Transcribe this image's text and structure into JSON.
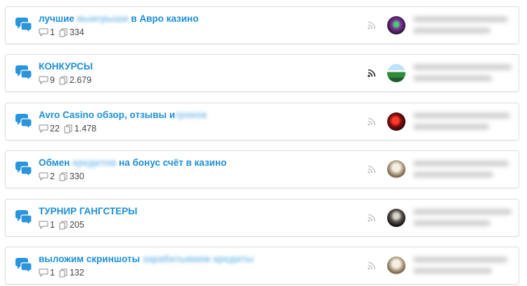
{
  "colors": {
    "link": "#1c8fd6",
    "icon": "#2a94dc",
    "rss_inactive": "#c8c8c8",
    "rss_active": "#222222"
  },
  "icons": {
    "forum": "speech-bubbles-icon",
    "replies": "comment-icon",
    "views": "copy-icon",
    "feed": "rss-icon"
  },
  "forums": [
    {
      "title_parts": [
        "лучшие ",
        "выигрыши",
        " в Авро казино"
      ],
      "replies": "1",
      "views": "334",
      "rss_active": false
    },
    {
      "title_parts": [
        "КОНКУРСЫ",
        "",
        ""
      ],
      "replies": "9",
      "views": "2.679",
      "rss_active": true
    },
    {
      "title_parts": [
        "Avro Casino обзор, отзывы и",
        "гроков",
        ""
      ],
      "replies": "22",
      "views": "1.478",
      "rss_active": false
    },
    {
      "title_parts": [
        "Обмен ",
        "кредитов",
        " на бонус счёт в казино"
      ],
      "replies": "2",
      "views": "330",
      "rss_active": false
    },
    {
      "title_parts": [
        "ТУРНИР ГАНГСТЕРЫ",
        "",
        ""
      ],
      "replies": "1",
      "views": "205",
      "rss_active": false
    },
    {
      "title_parts": [
        "выложим скриншоты ",
        "зарабатываем кредиты",
        ""
      ],
      "replies": "1",
      "views": "132",
      "rss_active": false
    }
  ]
}
